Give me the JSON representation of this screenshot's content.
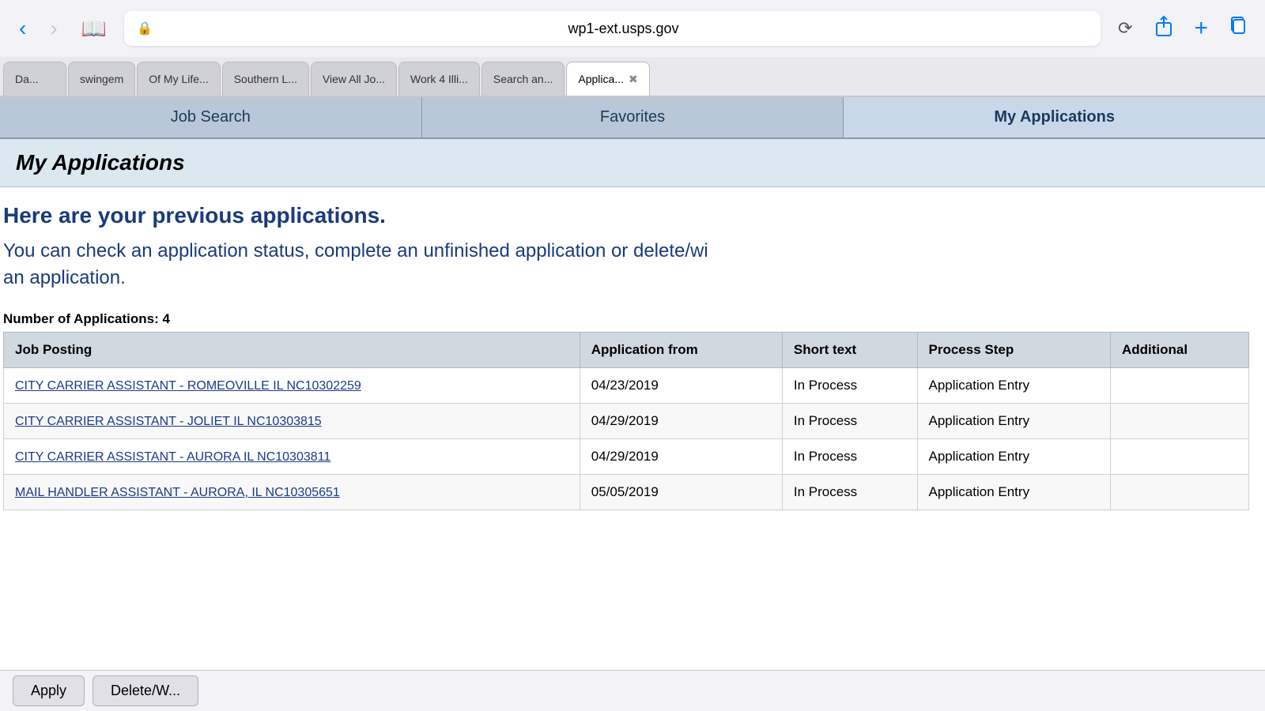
{
  "browser": {
    "url": "wp1-ext.usps.gov",
    "back_disabled": false,
    "forward_disabled": true
  },
  "tabs": [
    {
      "id": "tab-da",
      "label": "Da...",
      "active": false
    },
    {
      "id": "tab-swingem",
      "label": "swingem",
      "active": false
    },
    {
      "id": "tab-ofmylife",
      "label": "Of My Life...",
      "active": false
    },
    {
      "id": "tab-southern",
      "label": "Southern L...",
      "active": false
    },
    {
      "id": "tab-viewall",
      "label": "View All Jo...",
      "active": false
    },
    {
      "id": "tab-work4",
      "label": "Work 4 Illi...",
      "active": false
    },
    {
      "id": "tab-searchan",
      "label": "Search an...",
      "active": false
    },
    {
      "id": "tab-applica",
      "label": "Applica...",
      "active": true,
      "closeable": true
    }
  ],
  "sub_nav": {
    "items": [
      {
        "id": "job-search",
        "label": "Job Search",
        "active": false
      },
      {
        "id": "favorites",
        "label": "Favorites",
        "active": false
      },
      {
        "id": "my-applications",
        "label": "My Applications",
        "active": true
      }
    ]
  },
  "page": {
    "title": "My Applications",
    "intro_bold": "Here are your previous applications.",
    "intro_normal": "You can check an application status, complete an unfinished application or delete/wi\nan application.",
    "app_count_label": "Number of Applications: 4"
  },
  "table": {
    "headers": [
      {
        "id": "job-posting",
        "label": "Job Posting"
      },
      {
        "id": "app-from",
        "label": "Application from"
      },
      {
        "id": "short-text",
        "label": "Short text"
      },
      {
        "id": "process-step",
        "label": "Process Step"
      },
      {
        "id": "additional",
        "label": "Additional"
      }
    ],
    "rows": [
      {
        "job_posting": "CITY CARRIER ASSISTANT  -  ROMEOVILLE IL NC10302259",
        "app_from": "04/23/2019",
        "short_text": "In Process",
        "process_step": "Application Entry",
        "additional": ""
      },
      {
        "job_posting": "CITY CARRIER ASSISTANT  -  JOLIET IL NC10303815",
        "app_from": "04/29/2019",
        "short_text": "In Process",
        "process_step": "Application Entry",
        "additional": ""
      },
      {
        "job_posting": "CITY CARRIER ASSISTANT  -  AURORA IL NC10303811",
        "app_from": "04/29/2019",
        "short_text": "In Process",
        "process_step": "Application Entry",
        "additional": ""
      },
      {
        "job_posting": "MAIL HANDLER ASSISTANT - AURORA,  IL  NC10305651",
        "app_from": "05/05/2019",
        "short_text": "In Process",
        "process_step": "Application Entry",
        "additional": ""
      }
    ]
  },
  "buttons": {
    "apply": "Apply",
    "delete": "Delete/W..."
  }
}
